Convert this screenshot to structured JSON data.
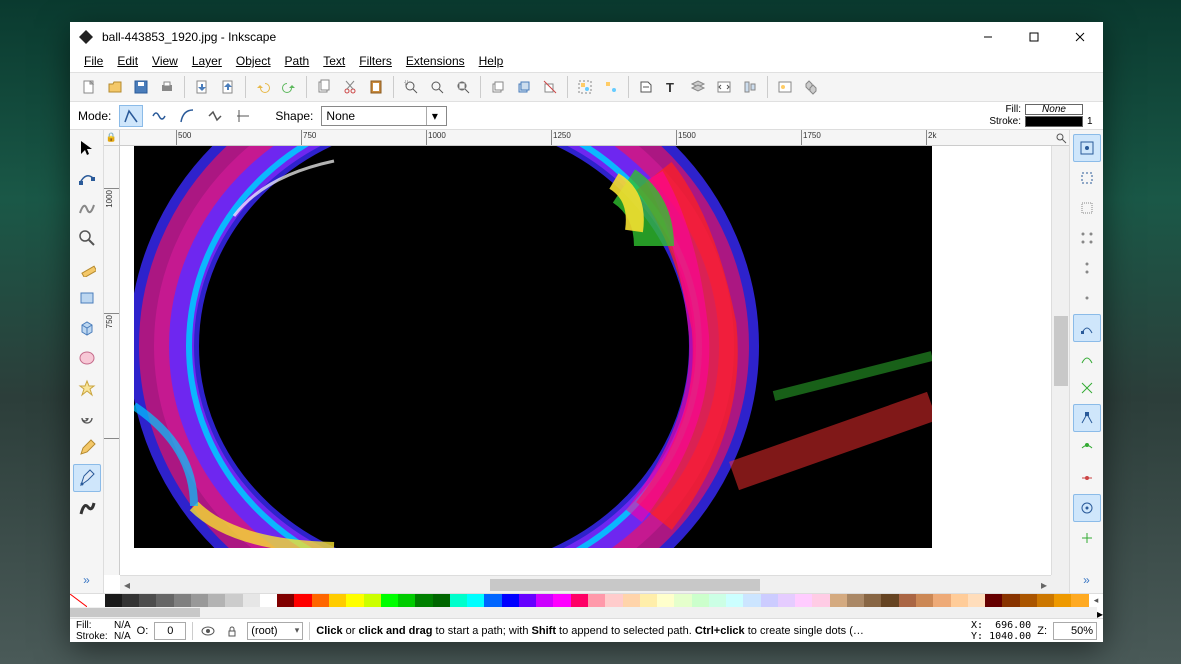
{
  "window": {
    "title": "ball-443853_1920.jpg - Inkscape"
  },
  "menus": [
    "File",
    "Edit",
    "View",
    "Layer",
    "Object",
    "Path",
    "Text",
    "Filters",
    "Extensions",
    "Help"
  ],
  "tooloptions": {
    "mode_label": "Mode:",
    "shape_label": "Shape:",
    "shape_value": "None",
    "fill_label": "Fill:",
    "fill_value": "None",
    "stroke_label": "Stroke:",
    "stroke_opacity": "1"
  },
  "ruler_h_ticks": [
    "500",
    "750",
    "1000",
    "1250",
    "1500",
    "1750",
    "2k"
  ],
  "ruler_v_ticks": [
    "1000",
    "750"
  ],
  "status": {
    "fill_label": "Fill:",
    "fill_value": "N/A",
    "stroke_label": "Stroke:",
    "stroke_value": "N/A",
    "opacity_label": "O:",
    "opacity_value": "0",
    "layer": "(root)",
    "hint_prefix": "Click",
    "hint_mid1": " or ",
    "hint_bold1": "click and drag",
    "hint_mid2": " to start a path; with ",
    "hint_bold2": "Shift",
    "hint_mid3": " to append to selected path. ",
    "hint_bold3": "Ctrl+click",
    "hint_suffix": " to create single dots (…",
    "coord_x_label": "X:",
    "coord_x": "696.00",
    "coord_y_label": "Y:",
    "coord_y": "1040.00",
    "zoom_label": "Z:",
    "zoom_value": "50%"
  },
  "palette": [
    "#ffffff",
    "#1a1a1a",
    "#333333",
    "#4d4d4d",
    "#666666",
    "#808080",
    "#999999",
    "#b3b3b3",
    "#cccccc",
    "#e6e6e6",
    "#ffffff",
    "#800000",
    "#ff0000",
    "#ff6600",
    "#ffcc00",
    "#ffff00",
    "#ccff00",
    "#00ff00",
    "#00cc00",
    "#008000",
    "#006600",
    "#00ffcc",
    "#00ffff",
    "#0066ff",
    "#0000ff",
    "#6600ff",
    "#cc00ff",
    "#ff00ff",
    "#ff0066",
    "#ff99aa",
    "#ffcccc",
    "#ffd4aa",
    "#ffeeaa",
    "#ffffcc",
    "#e5ffcc",
    "#ccffcc",
    "#ccffe5",
    "#ccffff",
    "#cce5ff",
    "#ccccff",
    "#e5ccff",
    "#ffccff",
    "#ffcce5",
    "#d4aa80",
    "#aa8866",
    "#886644",
    "#664422",
    "#aa6644",
    "#cc8855",
    "#eeaa77",
    "#ffcc99",
    "#ffddbb",
    "#660000",
    "#883300",
    "#aa5500",
    "#cc7700",
    "#ee9900",
    "#ffaa22"
  ]
}
